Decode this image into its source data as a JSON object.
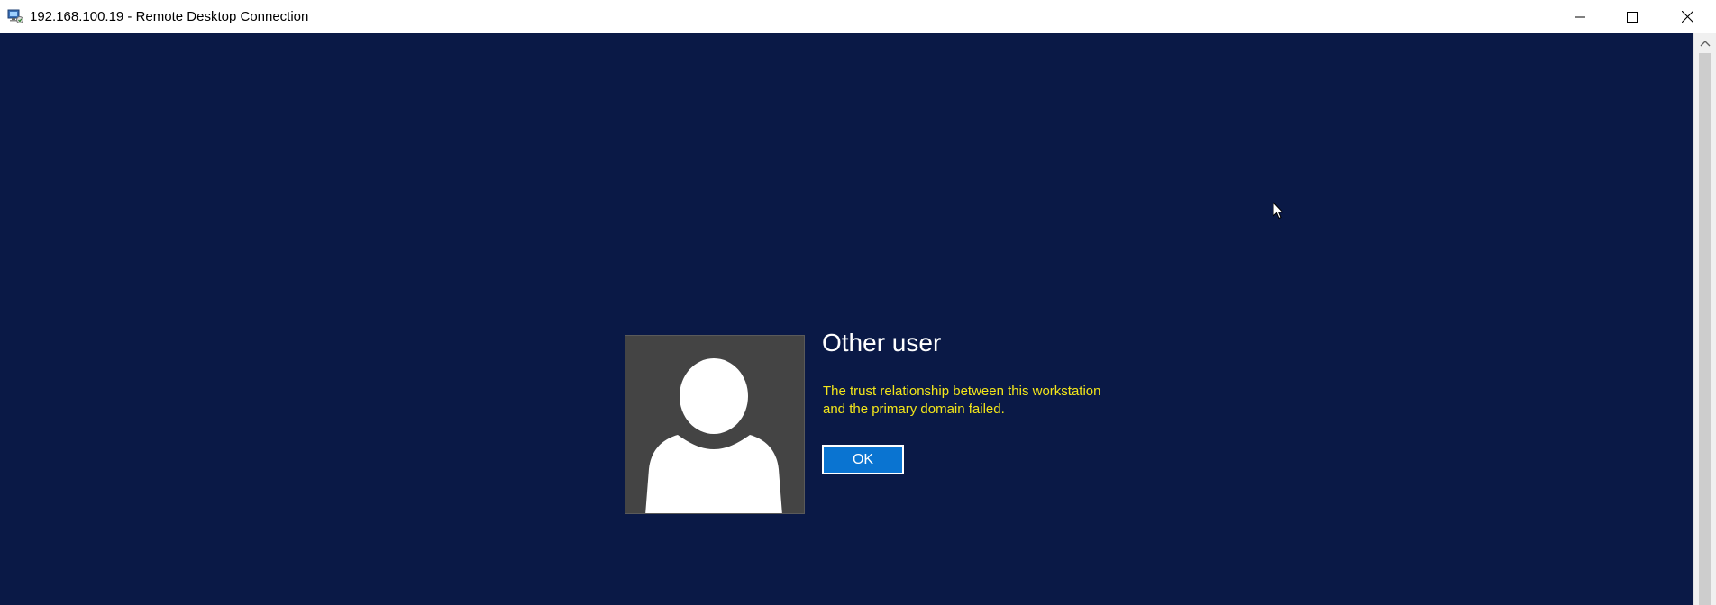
{
  "window": {
    "title": "192.168.100.19 - Remote Desktop Connection",
    "icons": {
      "app": "remote-desktop-icon",
      "minimize": "minimize-icon",
      "maximize": "maximize-icon",
      "close": "close-icon"
    }
  },
  "login": {
    "user_name": "Other user",
    "error_line1": "The trust relationship between this workstation",
    "error_line2": "and the primary domain failed.",
    "ok_label": "OK",
    "avatar_icon": "user-silhouette-icon"
  },
  "colors": {
    "desktop_bg": "#0a1946",
    "error_text": "#f3e61a",
    "ok_button_bg": "#0a74d1",
    "avatar_bg": "#444444"
  }
}
